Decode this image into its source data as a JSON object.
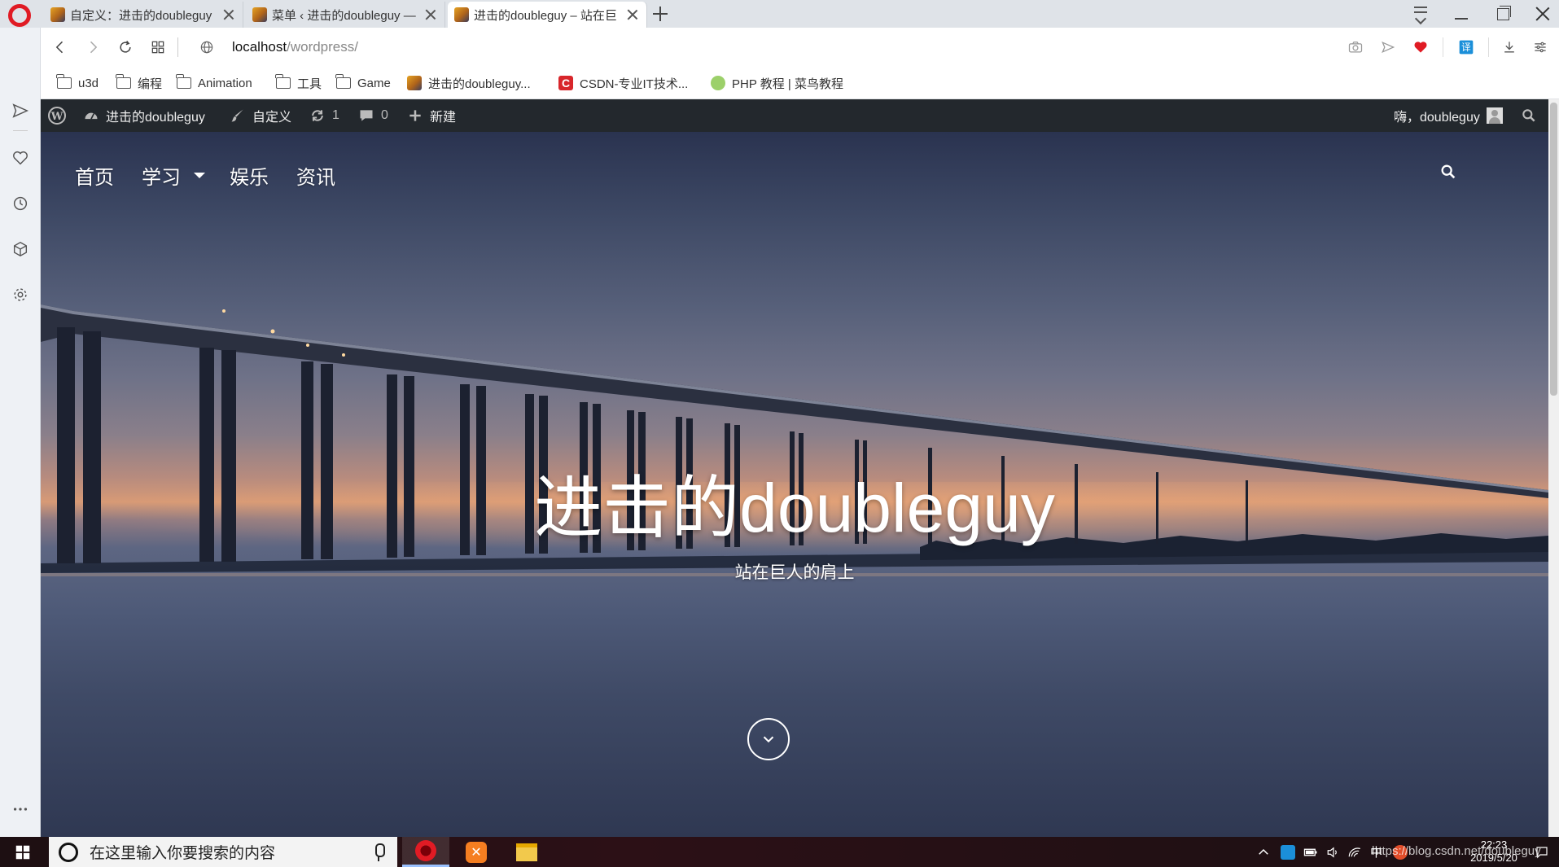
{
  "browser": {
    "tabs": [
      {
        "title": "自定义：进击的doubleguy",
        "active": false
      },
      {
        "title": "菜单 ‹ 进击的doubleguy —",
        "active": false
      },
      {
        "title": "进击的doubleguy – 站在巨",
        "active": true
      }
    ],
    "address": {
      "host": "localhost",
      "path": "/wordpress/"
    },
    "bookmarks": [
      {
        "label": "u3d",
        "icon": "folder-icon"
      },
      {
        "label": "编程",
        "icon": "folder-icon"
      },
      {
        "label": "Animation",
        "icon": "folder-icon"
      },
      {
        "label": "工具",
        "icon": "folder-icon"
      },
      {
        "label": "Game",
        "icon": "folder-icon"
      },
      {
        "label": "进击的doubleguy...",
        "icon": "wordpress-favicon"
      },
      {
        "label": "CSDN-专业IT技术...",
        "icon": "csdn-favicon",
        "glyph": "C"
      },
      {
        "label": "PHP 教程 | 菜鸟教程",
        "icon": "runoob-favicon"
      }
    ],
    "accent_color": "#e01b24"
  },
  "wp_admin_bar": {
    "site_name": "进击的doubleguy",
    "customize": "自定义",
    "updates_count": "1",
    "comments_count": "0",
    "new_label": "新建",
    "greeting": "嗨，doubleguy"
  },
  "site": {
    "menu": [
      {
        "label": "首页",
        "has_submenu": false
      },
      {
        "label": "学习",
        "has_submenu": true
      },
      {
        "label": "娱乐",
        "has_submenu": false
      },
      {
        "label": "资讯",
        "has_submenu": false
      }
    ],
    "title": "进击的doubleguy",
    "tagline": "站在巨人的肩上"
  },
  "taskbar": {
    "search_placeholder": "在这里输入你要搜索的内容",
    "apps": [
      "opera-icon",
      "xampp-icon",
      "file-explorer-icon"
    ],
    "clock_time": "22:23",
    "clock_date": "2019/5/20",
    "ime": "中"
  },
  "watermark": "https://blog.csdn.net/doubleguy"
}
